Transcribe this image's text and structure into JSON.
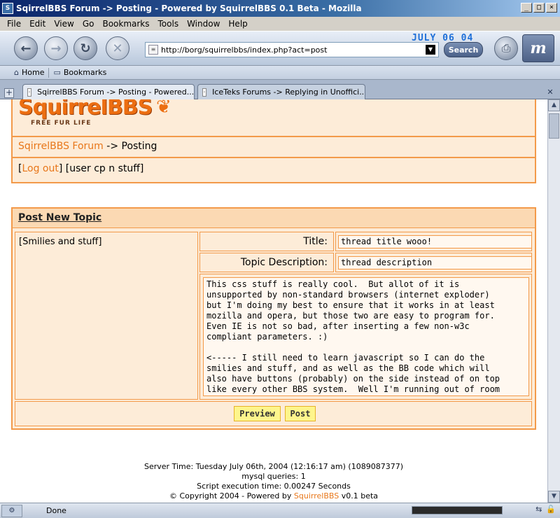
{
  "window": {
    "title": "SqirrelBBS Forum -> Posting - Powered by SquirrelBBS 0.1 Beta - Mozilla",
    "controls": {
      "minimize": "_",
      "maximize": "□",
      "close": "×"
    }
  },
  "menu": [
    "File",
    "Edit",
    "View",
    "Go",
    "Bookmarks",
    "Tools",
    "Window",
    "Help"
  ],
  "toolbar": {
    "url": "http://borg/squirrelbbs/index.php?act=post",
    "search_label": "Search",
    "date_stamp": "JULY 06 04"
  },
  "personal_toolbar": {
    "home": "Home",
    "bookmarks": "Bookmarks"
  },
  "tabs": [
    {
      "label": "SqirrelBBS Forum -> Posting - Powered...",
      "active": true
    },
    {
      "label": "IceTeks Forums -> Replying in Unoffici...",
      "active": false
    }
  ],
  "page": {
    "logo": {
      "name": "SquirrelBBS",
      "tagline": "FREE FUR LIFE"
    },
    "breadcrumb": {
      "forum_link": "SqirrelBBS Forum",
      "sep": " -> ",
      "current": "Posting"
    },
    "user_bar": {
      "open": "[",
      "logout": "Log out",
      "close": "]",
      "user_cp": " [user cp n stuff]"
    },
    "post_form": {
      "heading": "Post New Topic",
      "sidebar_text": "[Smilies and stuff]",
      "title_label": "Title:",
      "title_value": "thread title wooo!",
      "desc_label": "Topic Description:",
      "desc_value": "thread description",
      "body": "This css stuff is really cool.  But allot of it is\nunsupported by non-standard browsers (internet exploder)\nbut I'm doing my best to ensure that it works in at least\nmozilla and opera, but those two are easy to program for.\nEven IE is not so bad, after inserting a few non-w3c\ncompliant parameters. :)\n\n<----- I still need to learn javascript so I can do the\nsmilies and stuff, and as well as the BB code which will\nalso have buttons (probably) on the side instead of on top\nlike every other BBS system.  Well I'm running out of room",
      "preview_button": "Preview",
      "post_button": "Post"
    },
    "footer": {
      "server_time": "Server Time: Tuesday July 06th, 2004 (12:16:17 am) (1089087377)",
      "queries": "mysql queries: 1",
      "exec_time": "Script execution time: 0.00247 Seconds",
      "copyright_pre": "© Copyright 2004 - Powered by ",
      "copyright_link": "SquirrelBBS",
      "copyright_post": " v0.1 beta"
    }
  },
  "status": {
    "message": "Done"
  }
}
